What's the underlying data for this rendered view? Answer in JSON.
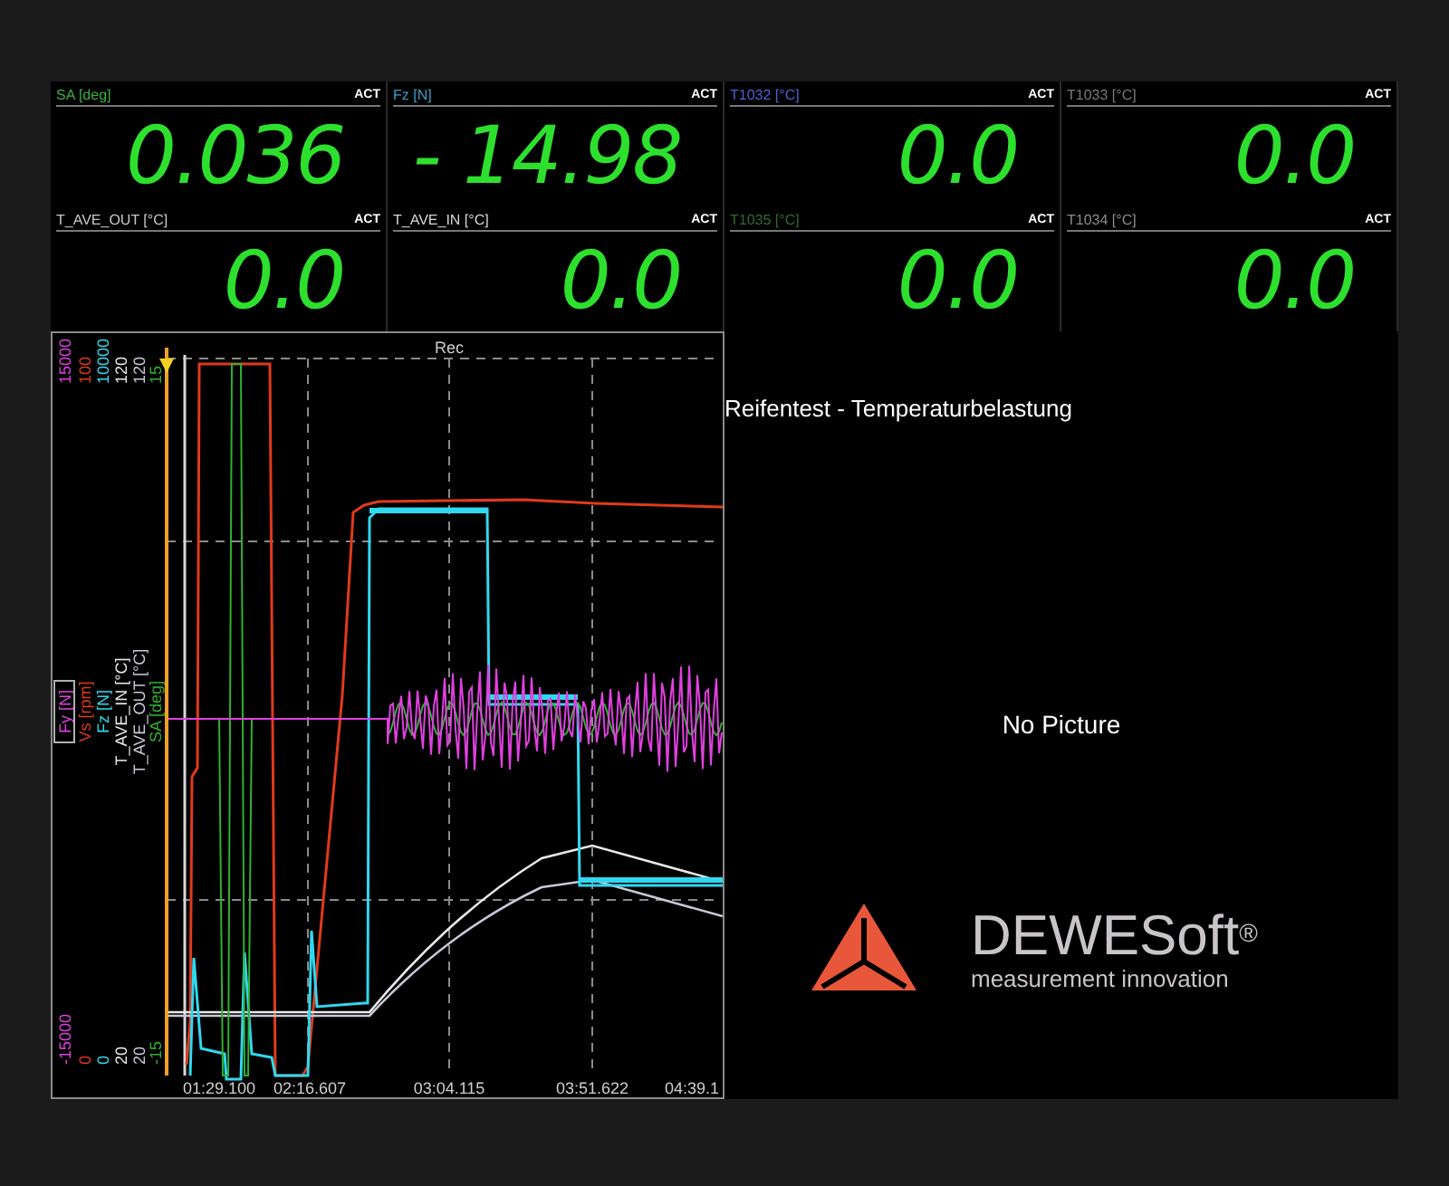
{
  "meters": [
    {
      "title": "SA [deg]",
      "color": "#3cb043",
      "status": "ACT",
      "value": "0.036"
    },
    {
      "title": "Fz [N]",
      "color": "#3a9fc8",
      "status": "ACT",
      "value": "- 14.98"
    },
    {
      "title": "T1032 [°C]",
      "color": "#4a62d0",
      "status": "ACT",
      "value": "0.0"
    },
    {
      "title": "T1033 [°C]",
      "color": "#7a7a7a",
      "status": "ACT",
      "value": "0.0"
    },
    {
      "title": "T_AVE_OUT [°C]",
      "color": "#c8c8c8",
      "status": "ACT",
      "value": "0.0"
    },
    {
      "title": "T_AVE_IN [°C]",
      "color": "#d8d8d8",
      "status": "ACT",
      "value": "0.0"
    },
    {
      "title": "T1035 [°C]",
      "color": "#2f6a2f",
      "status": "ACT",
      "value": "0.0"
    },
    {
      "title": "T1034 [°C]",
      "color": "#8c8c8c",
      "status": "ACT",
      "value": "0.0"
    }
  ],
  "recorder": {
    "marker": "Rec",
    "axes": [
      {
        "name": "Fy [N]",
        "color": "#e040e0",
        "max": "15000",
        "min": "-15000",
        "selected": true
      },
      {
        "name": "Vs [rpm]",
        "color": "#e03a1a",
        "max": "100",
        "min": "0",
        "selected": false
      },
      {
        "name": "Fz [N]",
        "color": "#30d8f0",
        "max": "10000",
        "min": "0",
        "selected": false
      },
      {
        "name": "T_AVE_IN [°C]",
        "color": "#e8e8e8",
        "max": "120",
        "min": "20",
        "selected": false
      },
      {
        "name": "T_AVE_OUT [°C]",
        "color": "#c8c8d8",
        "max": "120",
        "min": "20",
        "selected": false
      },
      {
        "name": "SA [deg]",
        "color": "#30b030",
        "max": "15",
        "min": "-15",
        "selected": false
      }
    ],
    "time_labels": [
      "01:29.100",
      "02:16.607",
      "03:04.115",
      "03:51.622",
      "04:39.1"
    ]
  },
  "text_panel": {
    "title": "Reifentest - Temperaturbelastung",
    "image_message": "No Picture",
    "logo": {
      "wordmark": "DEWESoft$^{®}$",
      "tagline": "measurement innovation"
    }
  }
}
